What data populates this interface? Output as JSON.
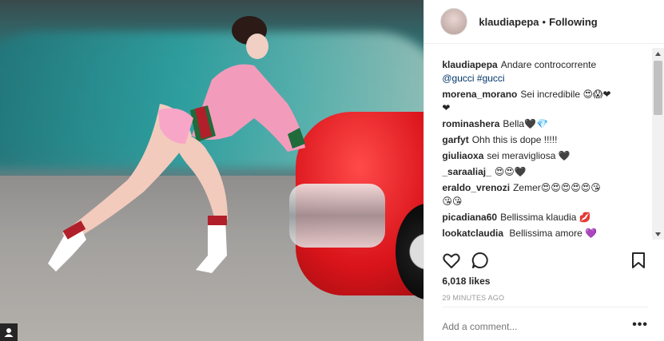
{
  "header": {
    "username": "klaudiapepa",
    "separator": "•",
    "follow_state": "Following"
  },
  "comments": [
    {
      "author": "klaudiapepa",
      "text": "Andare controcorrente",
      "tags": "@gucci #gucci"
    },
    {
      "author": "morena_morano",
      "text": "Sei incredibile",
      "emoji": "😍😱❤",
      "emoji2": "❤"
    },
    {
      "author": "rominashera",
      "text": "Bella",
      "emoji": "🖤💎"
    },
    {
      "author": "garfyt",
      "text": "Ohh this is dope !!!!!"
    },
    {
      "author": "giuliaoxa",
      "text": "sei meravigliosa",
      "emoji": "🖤"
    },
    {
      "author": "_saraaliaj_",
      "text": "",
      "emoji": "😍😍🖤"
    },
    {
      "author": "eraldo_vrenozi",
      "text": "Zemer",
      "emoji": "😍😍😍😍😍😘",
      "emoji2": "😘😘"
    },
    {
      "author": "picadiana60",
      "text": "Bellissima klaudia",
      "emoji": "💋"
    },
    {
      "author": "lookatclaudia",
      "text": "Bellissima amore",
      "emoji": "💜"
    }
  ],
  "likes": "6,018 likes",
  "time": "29 MINUTES AGO",
  "add_comment_placeholder": "Add a comment...",
  "more_label": "•••",
  "icons": {
    "like": "heart-icon",
    "comment": "comment-bubble-icon",
    "save": "bookmark-icon",
    "user_tag": "person-icon"
  },
  "colors": {
    "text": "#262626",
    "muted": "#999999",
    "link": "#003569",
    "border": "#efefef"
  }
}
